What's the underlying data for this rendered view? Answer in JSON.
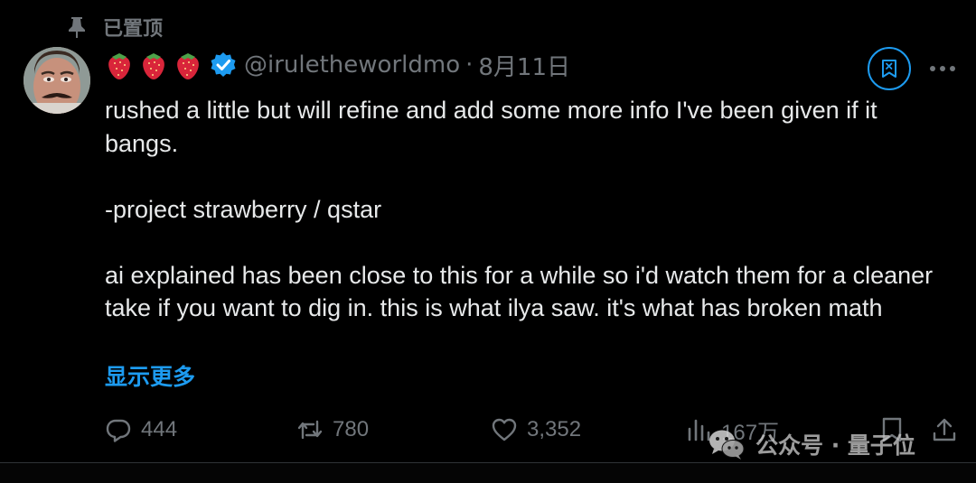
{
  "pinned": {
    "label": "已置顶"
  },
  "author": {
    "name_emojis": [
      "strawberry",
      "strawberry",
      "strawberry"
    ],
    "verified": true,
    "handle": "@iruletheworldmo",
    "separator": "·",
    "date": "8月11日"
  },
  "body": {
    "lines": [
      "rushed a little but will refine and add some more info I've been given if it bangs.",
      "-project strawberry / qstar",
      "ai explained has been close to this for a while so i'd watch them for a cleaner take if you want to dig in. this is what ilya saw. it's what has broken math"
    ],
    "show_more": "显示更多"
  },
  "actions": {
    "replies": "444",
    "reposts": "780",
    "likes": "3,352",
    "views": "167万"
  },
  "watermark": {
    "text": "公众号 · 量子位"
  },
  "icons": {
    "pin": "pin-icon",
    "verified": "verified-badge-icon",
    "grok": "grok-icon",
    "more": "more-icon",
    "reply": "reply-icon",
    "repost": "repost-icon",
    "like": "heart-icon",
    "views": "views-icon",
    "bookmark": "bookmark-icon",
    "share": "share-icon",
    "wechat": "wechat-icon"
  },
  "colors": {
    "background": "#000000",
    "text": "#e7e9ea",
    "muted": "#71767b",
    "accent": "#1d9bf0"
  }
}
